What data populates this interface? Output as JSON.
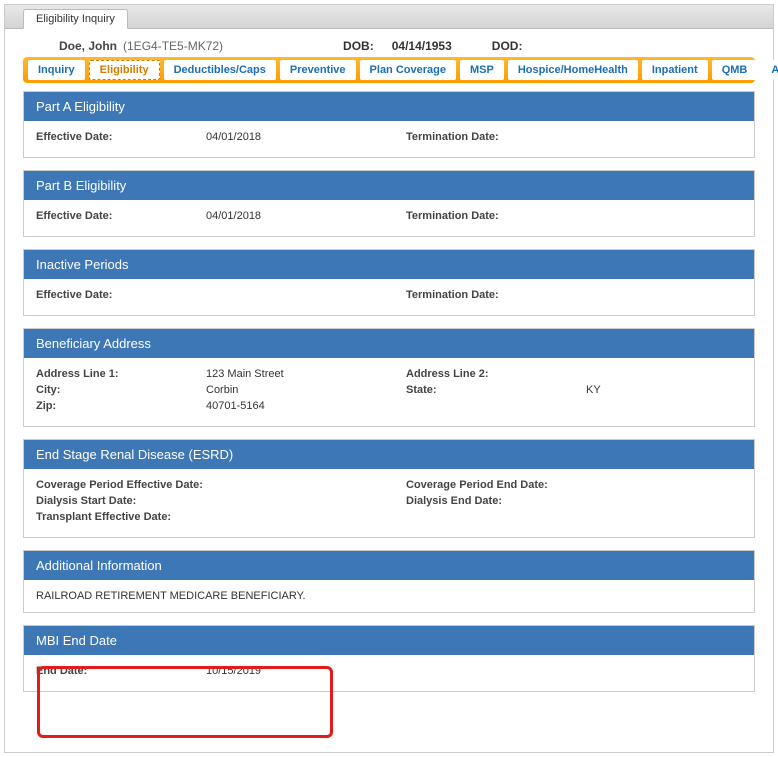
{
  "topTab": "Eligibility Inquiry",
  "patient": {
    "name": "Doe, John",
    "id": "(1EG4-TE5-MK72)",
    "dobLabel": "DOB:",
    "dob": "04/14/1953",
    "dodLabel": "DOD:",
    "dod": ""
  },
  "navTabs": [
    "Inquiry",
    "Eligibility",
    "Deductibles/Caps",
    "Preventive",
    "Plan Coverage",
    "MSP",
    "Hospice/HomeHealth",
    "Inpatient",
    "QMB",
    "All screens"
  ],
  "activeTab": "Eligibility",
  "partA": {
    "title": "Part A Eligibility",
    "effLabel": "Effective Date:",
    "effVal": "04/01/2018",
    "termLabel": "Termination Date:",
    "termVal": ""
  },
  "partB": {
    "title": "Part B Eligibility",
    "effLabel": "Effective Date:",
    "effVal": "04/01/2018",
    "termLabel": "Termination Date:",
    "termVal": ""
  },
  "inactive": {
    "title": "Inactive Periods",
    "effLabel": "Effective Date:",
    "effVal": "",
    "termLabel": "Termination Date:",
    "termVal": ""
  },
  "address": {
    "title": "Beneficiary Address",
    "line1Label": "Address Line 1:",
    "line1": "123 Main Street",
    "line2Label": "Address Line 2:",
    "line2": "",
    "cityLabel": "City:",
    "city": "Corbin",
    "stateLabel": "State:",
    "state": "KY",
    "zipLabel": "Zip:",
    "zip": "40701-5164"
  },
  "esrd": {
    "title": "End Stage Renal Disease (ESRD)",
    "covEffLabel": "Coverage Period Effective Date:",
    "covEffVal": "",
    "covEndLabel": "Coverage Period End Date:",
    "covEndVal": "",
    "dialStartLabel": "Dialysis Start Date:",
    "dialStartVal": "",
    "dialEndLabel": "Dialysis End Date:",
    "dialEndVal": "",
    "transLabel": "Transplant Effective Date:",
    "transVal": ""
  },
  "additional": {
    "title": "Additional Information",
    "text": "RAILROAD RETIREMENT MEDICARE BENEFICIARY."
  },
  "mbi": {
    "title": "MBI End Date",
    "endLabel": "End Date:",
    "endVal": "10/15/2019"
  }
}
